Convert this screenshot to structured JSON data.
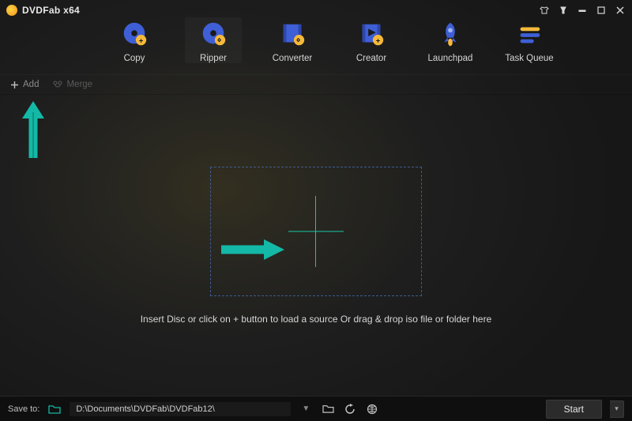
{
  "app": {
    "title": "DVDFab x64"
  },
  "tabs": [
    {
      "label": "Copy"
    },
    {
      "label": "Ripper"
    },
    {
      "label": "Converter"
    },
    {
      "label": "Creator"
    },
    {
      "label": "Launchpad"
    },
    {
      "label": "Task Queue"
    }
  ],
  "active_tab_index": 1,
  "toolbar": {
    "add_label": "Add",
    "merge_label": "Merge"
  },
  "dropzone": {
    "hint": "Insert Disc or click on + button to load a source Or drag & drop iso file or folder here"
  },
  "bottom": {
    "save_to_label": "Save to:",
    "save_path": "D:\\Documents\\DVDFab\\DVDFab12\\",
    "start_label": "Start"
  },
  "colors": {
    "accent_blue": "#3f5fd6",
    "accent_yellow": "#f6b93b",
    "teal": "#14b8a6",
    "dropzone_border": "#3d5b8f"
  }
}
